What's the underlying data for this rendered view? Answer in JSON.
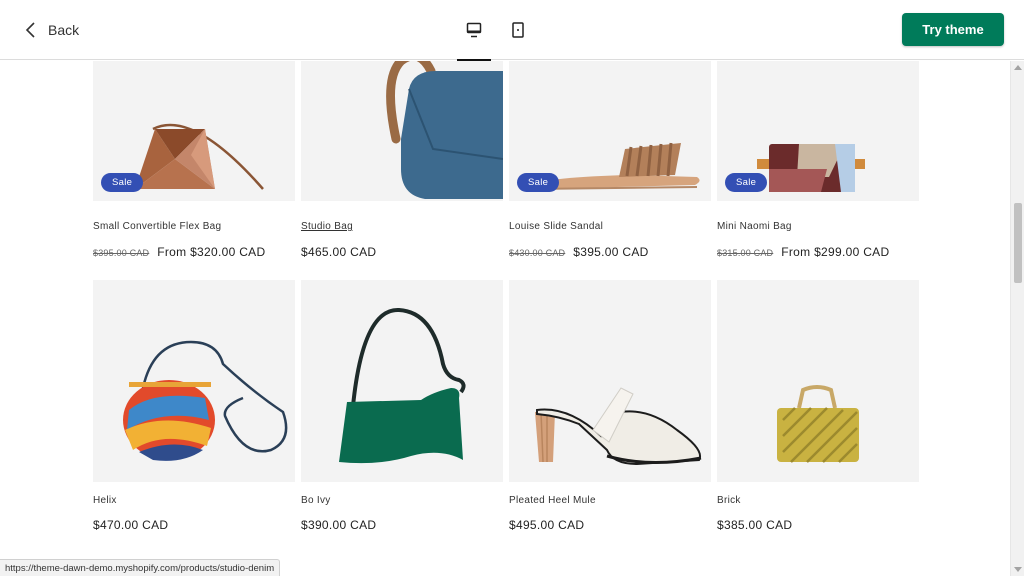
{
  "header": {
    "back_label": "Back",
    "try_theme_label": "Try theme"
  },
  "products": [
    {
      "title": "Small Convertible Flex Bag",
      "badge": "Sale",
      "original_price": "$395.00 CAD",
      "price": "From $320.00 CAD"
    },
    {
      "title": "Studio Bag",
      "badge": "",
      "original_price": "",
      "price": "$465.00 CAD"
    },
    {
      "title": "Louise Slide Sandal",
      "badge": "Sale",
      "original_price": "$430.00 CAD",
      "price": "$395.00 CAD"
    },
    {
      "title": "Mini Naomi Bag",
      "badge": "Sale",
      "original_price": "$315.00 CAD",
      "price": "From $299.00 CAD"
    },
    {
      "title": "Helix",
      "badge": "",
      "original_price": "",
      "price": "$470.00 CAD"
    },
    {
      "title": "Bo Ivy",
      "badge": "",
      "original_price": "",
      "price": "$390.00 CAD"
    },
    {
      "title": "Pleated Heel Mule",
      "badge": "",
      "original_price": "",
      "price": "$495.00 CAD"
    },
    {
      "title": "Brick",
      "badge": "",
      "original_price": "",
      "price": "$385.00 CAD"
    }
  ],
  "status_bar": {
    "url": "https://theme-dawn-demo.myshopify.com/products/studio-denim"
  },
  "colors": {
    "accent": "#007b5a",
    "sale_badge": "#334fb4"
  },
  "icons": {
    "back": "chevron-left-icon",
    "desktop": "desktop-icon",
    "mobile": "mobile-icon"
  }
}
